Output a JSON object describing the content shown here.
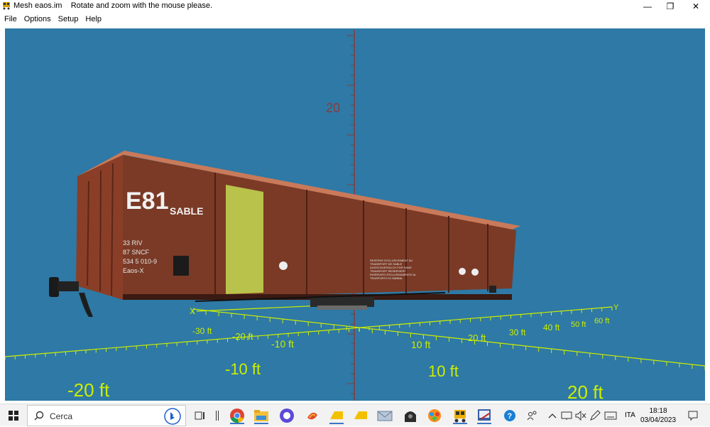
{
  "window": {
    "title": "Mesh eaos.im",
    "hint": "Rotate and zoom with the mouse please.",
    "controls": {
      "minimize": "—",
      "restore": "❐",
      "close": "✕"
    }
  },
  "menu": {
    "items": [
      "File",
      "Options",
      "Setup",
      "Help"
    ]
  },
  "scene": {
    "background": "#2e79a5",
    "axis_color": "#ccee00",
    "vertical_axis_color": "#8a3a3a",
    "vertical_label": "20",
    "x_axis_label": "X",
    "y_axis_label": "Y",
    "x_axis_ticks": [
      "-30 ft",
      "-20 ft",
      "-10 ft",
      "10 ft",
      "20 ft",
      "30 ft",
      "40 ft",
      "50 ft",
      "60 ft"
    ],
    "floor_labels": [
      "-20 ft",
      "-10 ft",
      "10 ft",
      "20 ft"
    ],
    "wagon": {
      "body_color": "#7a3a26",
      "door_color": "#b9c24a",
      "code": "E81",
      "name": "SABLE",
      "markings": [
        "33 RIV",
        "87 SNCF",
        "534 5 010-9",
        "Eaos-X"
      ],
      "door_notice": [
        "RESERVE EXCLUSIVEMENT AU",
        "TRANSPORT DE SABLE",
        "AUSSCHLIESSLICH FUR SAND",
        "TRANSPORT RESERVIERT",
        "RISERVATO ESCLUSIVAMENTE AL",
        "TRASPORTO DI SABBIA"
      ]
    }
  },
  "taskbar": {
    "search_placeholder": "Cerca",
    "language": "ITA",
    "time": "18:18",
    "date": "03/04/2023",
    "apps": [
      "task-view",
      "separator",
      "chrome",
      "file-explorer",
      "github",
      "app-red",
      "app-yellow-1",
      "app-yellow-2",
      "mail",
      "app-dark",
      "app-colorful",
      "app-mesh",
      "app-editor"
    ]
  }
}
